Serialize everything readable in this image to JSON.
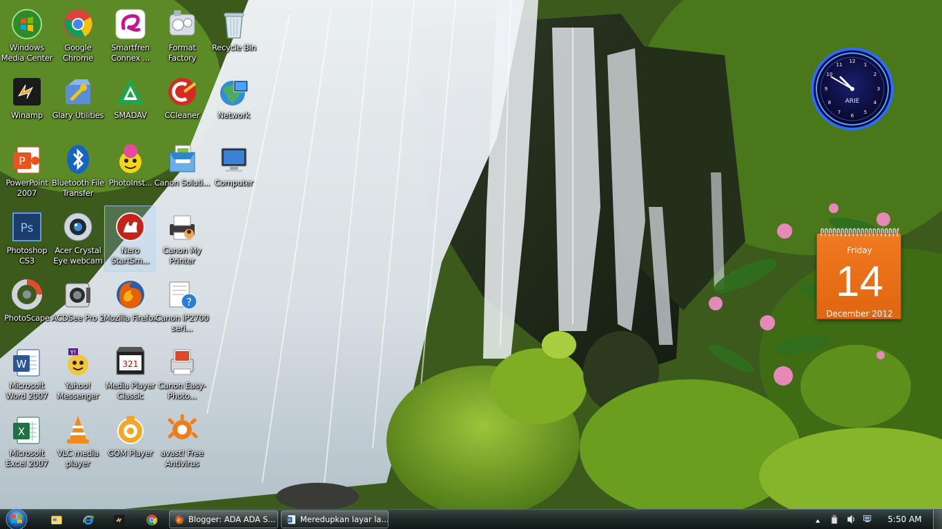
{
  "desktop": {
    "icons": [
      {
        "label": "Windows Media Center",
        "icon": "windows-media-center-icon"
      },
      {
        "label": "Google Chrome",
        "icon": "chrome-icon"
      },
      {
        "label": "Smartfren Connex ...",
        "icon": "smartfren-icon"
      },
      {
        "label": "Format Factory",
        "icon": "format-factory-icon"
      },
      {
        "label": "Recycle Bin",
        "icon": "recycle-bin-icon"
      },
      {
        "label": "Winamp",
        "icon": "winamp-icon"
      },
      {
        "label": "Glary Utilities",
        "icon": "glary-utilities-icon"
      },
      {
        "label": "SMADAV",
        "icon": "smadav-icon"
      },
      {
        "label": "CCleaner",
        "icon": "ccleaner-icon"
      },
      {
        "label": "Network",
        "icon": "network-icon"
      },
      {
        "label": "PowerPoint 2007",
        "icon": "powerpoint-icon"
      },
      {
        "label": "Bluetooth File Transfer",
        "icon": "bluetooth-icon"
      },
      {
        "label": "PhotoInst...",
        "icon": "photoinstrument-icon"
      },
      {
        "label": "Canon Soluti...",
        "icon": "canon-solution-icon"
      },
      {
        "label": "Computer",
        "icon": "computer-icon"
      },
      {
        "label": "Photoshop CS3",
        "icon": "photoshop-icon"
      },
      {
        "label": "Acer Crystal Eye webcam",
        "icon": "webcam-icon"
      },
      {
        "label": "Nero StartSm...",
        "icon": "nero-icon"
      },
      {
        "label": "Canon My Printer",
        "icon": "printer-icon"
      },
      {
        "label": "PhotoScape",
        "icon": "photoscape-icon"
      },
      {
        "label": "ACDSee Pro 2",
        "icon": "acdsee-icon"
      },
      {
        "label": "Mozilla Firefox",
        "icon": "firefox-icon"
      },
      {
        "label": "Canon iP2700 seri...",
        "icon": "help-manual-icon"
      },
      {
        "label": "Microsoft Word 2007",
        "icon": "word-icon"
      },
      {
        "label": "Yahoo! Messenger",
        "icon": "yahoo-messenger-icon"
      },
      {
        "label": "Media Player Classic",
        "icon": "media-player-classic-icon"
      },
      {
        "label": "Canon Easy-Photo...",
        "icon": "canon-easy-photoprint-icon"
      },
      {
        "label": "Microsoft Excel 2007",
        "icon": "excel-icon"
      },
      {
        "label": "VLC media player",
        "icon": "vlc-icon"
      },
      {
        "label": "GOM Player",
        "icon": "gom-player-icon"
      },
      {
        "label": "avast! Free Antivirus",
        "icon": "avast-icon"
      }
    ]
  },
  "gadgets": {
    "clock": {
      "brand": "ARIE",
      "time": "5:50"
    },
    "calendar": {
      "day": "Friday",
      "date": "14",
      "month": "December 2012"
    }
  },
  "taskbar": {
    "quick_launch": [
      "explorer-icon",
      "internet-explorer-icon",
      "winamp-icon",
      "chrome-icon"
    ],
    "tasks": [
      {
        "label": "Blogger: ADA ADA S...",
        "icon": "firefox-icon"
      },
      {
        "label": "Meredupkan layar la...",
        "icon": "word-icon"
      }
    ],
    "tray_icons": [
      "show-hidden-icons-arrow",
      "usb-device-icon",
      "volume-icon",
      "network-status-icon"
    ],
    "clock": "5:50 AM"
  }
}
